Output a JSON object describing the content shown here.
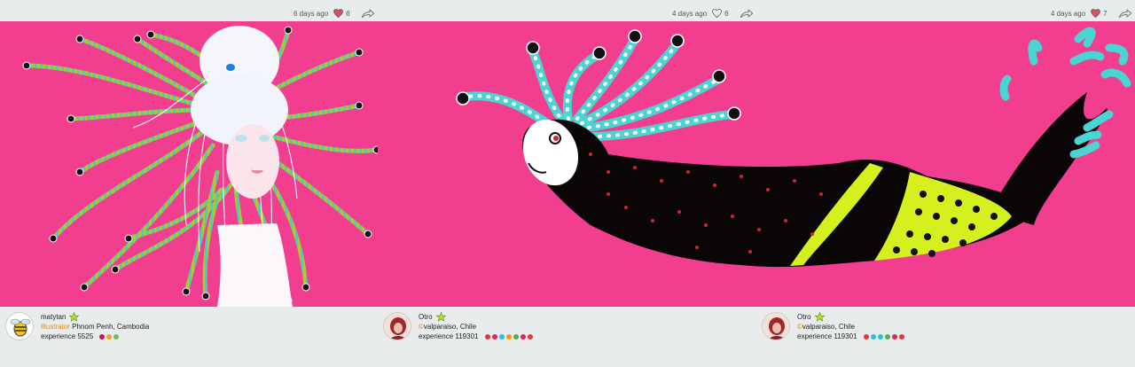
{
  "posts": [
    {
      "time": "6 days ago",
      "likes": "6",
      "author": {
        "name": "matytan",
        "role": "Illustrator",
        "location": "Phnom Penh, Cambodia",
        "experience": "experience 5525",
        "dots": [
          "#c2185b",
          "#f4a225",
          "#6cbf4c"
        ]
      }
    },
    {
      "time": "4 days ago",
      "likes": "6",
      "author": {
        "name": "Otro",
        "copy_symbol": "©",
        "location": "valparaiso, Chile",
        "experience": "experience 119301",
        "dots": [
          "#e53935",
          "#e91e63",
          "#26c6da",
          "#ff9800",
          "#4caf50",
          "#e91e63",
          "#e53935"
        ]
      }
    },
    {
      "time": "4 days ago",
      "likes": "7",
      "author": {
        "name": "Otro",
        "copy_symbol": "©",
        "location": "valparaiso, Chile",
        "experience": "experience 119301",
        "dots": [
          "#e53935",
          "#26c6da",
          "#26c6da",
          "#4caf50",
          "#e91e63",
          "#e53935"
        ]
      }
    }
  ],
  "colors": {
    "artwork_bg": "#f23e8f",
    "tentacle_cyan": "#3fd3c8",
    "tentacle_green": "#a7c93a",
    "lime": "#d6ef1e",
    "accent_orange": "#e38a13"
  },
  "icons": {
    "like": "heart-icon",
    "share": "share-arrow-icon",
    "badge": "star-icon"
  }
}
